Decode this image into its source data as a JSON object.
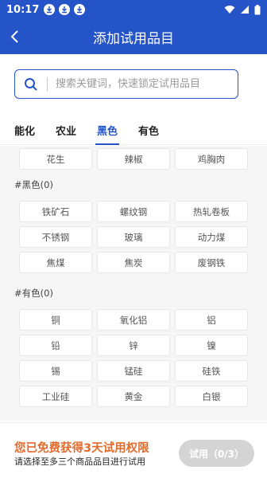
{
  "status": {
    "time": "10:17"
  },
  "header": {
    "title": "添加试用品目"
  },
  "search": {
    "placeholder": "搜索关键词，快速锁定试用品目"
  },
  "tabs": [
    {
      "label": "能化",
      "active": false
    },
    {
      "label": "农业",
      "active": false
    },
    {
      "label": "黑色",
      "active": true
    },
    {
      "label": "有色",
      "active": false
    }
  ],
  "partial_row": [
    "花生",
    "辣椒",
    "鸡胸肉"
  ],
  "sections": [
    {
      "label": "#黑色(0)",
      "items": [
        "铁矿石",
        "螺纹钢",
        "热轧卷板",
        "不锈钢",
        "玻璃",
        "动力煤",
        "焦煤",
        "焦炭",
        "废钢铁"
      ]
    },
    {
      "label": "#有色(0)",
      "items": [
        "铜",
        "氧化铝",
        "铝",
        "铅",
        "锌",
        "镍",
        "锡",
        "锰硅",
        "硅铁",
        "工业硅",
        "黄金",
        "白银"
      ]
    }
  ],
  "footer": {
    "promo": "您已免费获得3天试用权限",
    "hint": "请选择至多三个商品品目进行试用",
    "try_button": "试用（0/3）"
  },
  "colors": {
    "primary": "#2454c8",
    "accent": "#e26a2c",
    "disabled": "#d4d4d4"
  }
}
